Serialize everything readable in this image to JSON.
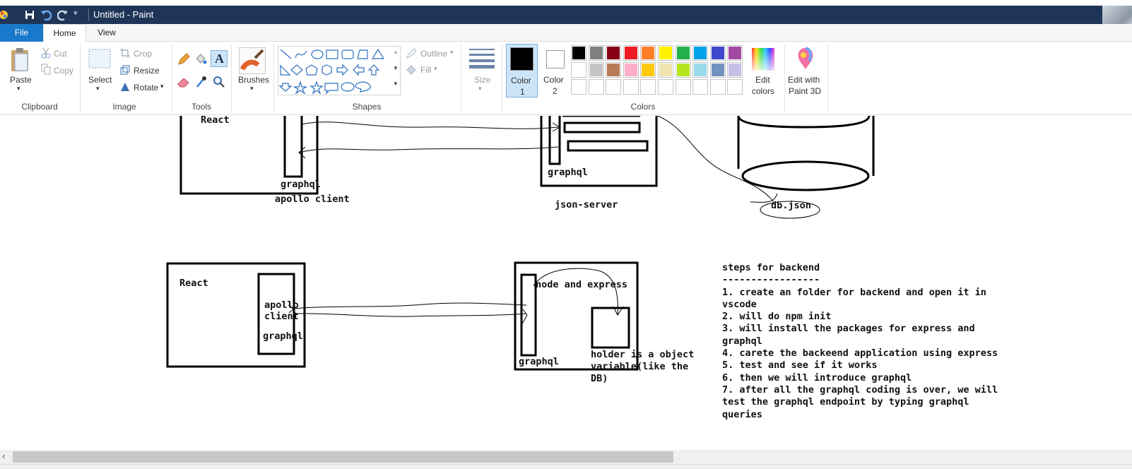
{
  "window": {
    "title": "Untitled - Paint"
  },
  "tabs": {
    "file": "File",
    "home": "Home",
    "view": "View"
  },
  "clipboard": {
    "paste": "Paste",
    "cut": "Cut",
    "copy": "Copy",
    "label": "Clipboard"
  },
  "image": {
    "select": "Select",
    "crop": "Crop",
    "resize": "Resize",
    "rotate": "Rotate",
    "label": "Image"
  },
  "tools": {
    "label": "Tools"
  },
  "brushes": {
    "label": "Brushes"
  },
  "shapes": {
    "label": "Shapes",
    "outline": "Outline",
    "fill": "Fill"
  },
  "size": {
    "label": "Size"
  },
  "colors": {
    "label": "Colors",
    "color1": "Color 1",
    "color1_a": "Color",
    "color1_b": "1",
    "color2_a": "Color",
    "color2_b": "2",
    "edit_a": "Edit",
    "edit_b": "colors",
    "paint3d_a": "Edit with",
    "paint3d_b": "Paint 3D",
    "palette_row1": [
      "#000000",
      "#7f7f7f",
      "#880015",
      "#ed1c24",
      "#ff7f27",
      "#fff200",
      "#22b14c",
      "#00a2e8",
      "#3f48cc",
      "#a349a4"
    ],
    "palette_row2": [
      "#ffffff",
      "#c3c3c3",
      "#b97a57",
      "#ffaec9",
      "#ffc90e",
      "#efe4b0",
      "#b5e61d",
      "#99d9ea",
      "#7092be",
      "#c8bfe7"
    ]
  },
  "canvas": {
    "top_react": "React",
    "top_graphql": "graphql",
    "top_apollo": "apollo client",
    "top_server_graphql": "graphql",
    "top_server_label": "json-server",
    "db_label": "db.json",
    "bot_react": "React",
    "bot_apollo1": "apollo",
    "bot_apollo2": "client",
    "bot_graphql": "graphql",
    "node_express": "node and express",
    "bot_server_graphql": "graphql",
    "holder1": "holder is a object",
    "holder2": "variable(like the",
    "holder3": "DB)",
    "steps": [
      "steps for backend",
      "-----------------",
      "1. create an folder for backend and open it in",
      "vscode",
      "2. will do npm init",
      "3. will install the packages for express and",
      "graphql",
      "4. carete the backeend application using express",
      "5. test and see if it works",
      "6. then we will introduce graphql",
      "7. after all the graphql coding is over, we will",
      "test the graphql endpoint by typing graphql",
      "queries"
    ]
  }
}
